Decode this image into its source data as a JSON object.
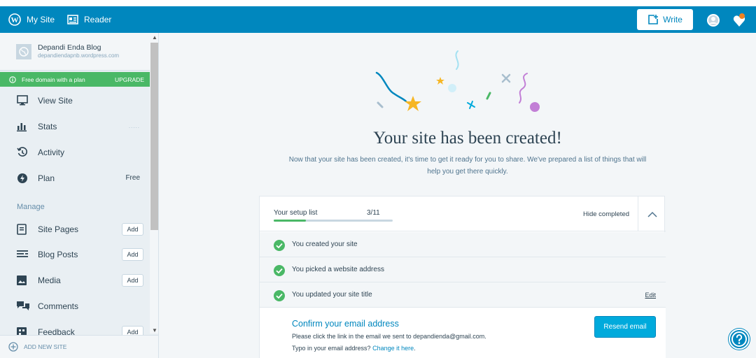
{
  "topbar": {
    "my_site": "My Site",
    "reader": "Reader",
    "write": "Write"
  },
  "sidebar": {
    "site_name": "Depandi Enda Blog",
    "site_url": "depandiendapnb.wordpress.com",
    "upgrade_text": "Free domain with a plan",
    "upgrade_label": "UPGRADE",
    "items": [
      {
        "label": "View Site"
      },
      {
        "label": "Stats",
        "extra": "....."
      },
      {
        "label": "Activity"
      },
      {
        "label": "Plan",
        "extra": "Free"
      }
    ],
    "manage_heading": "Manage",
    "manage_items": [
      {
        "label": "Site Pages",
        "action": "Add"
      },
      {
        "label": "Blog Posts",
        "action": "Add"
      },
      {
        "label": "Media",
        "action": "Add"
      },
      {
        "label": "Comments"
      },
      {
        "label": "Feedback",
        "action": "Add"
      }
    ],
    "add_new_site": "ADD NEW SITE"
  },
  "main": {
    "headline": "Your site has been created!",
    "subtext_line1": "Now that your site has been created, it's time to get it ready for you to share. We've prepared a list of things that will",
    "subtext_line2": "help you get there quickly.",
    "setup": {
      "title": "Your setup list",
      "count": "3/11",
      "progress": 0.27,
      "hide_completed": "Hide completed",
      "tasks": [
        {
          "label": "You created your site"
        },
        {
          "label": "You picked a website address"
        },
        {
          "label": "You updated your site title",
          "action": "Edit"
        }
      ],
      "active_task": {
        "title": "Confirm your email address",
        "desc": "Please click the link in the email we sent to depandienda@gmail.com.",
        "typo_prefix": "Typo in your email address?",
        "typo_link": "Change it here",
        "typo_suffix": ".",
        "button": "Resend email"
      }
    }
  },
  "colors": {
    "brand": "#0087be",
    "success": "#4ab866",
    "button": "#00aadc"
  },
  "icons": [
    "wordpress-icon",
    "reader-icon",
    "write-icon",
    "avatar-icon",
    "notifications-icon",
    "help-icon"
  ]
}
